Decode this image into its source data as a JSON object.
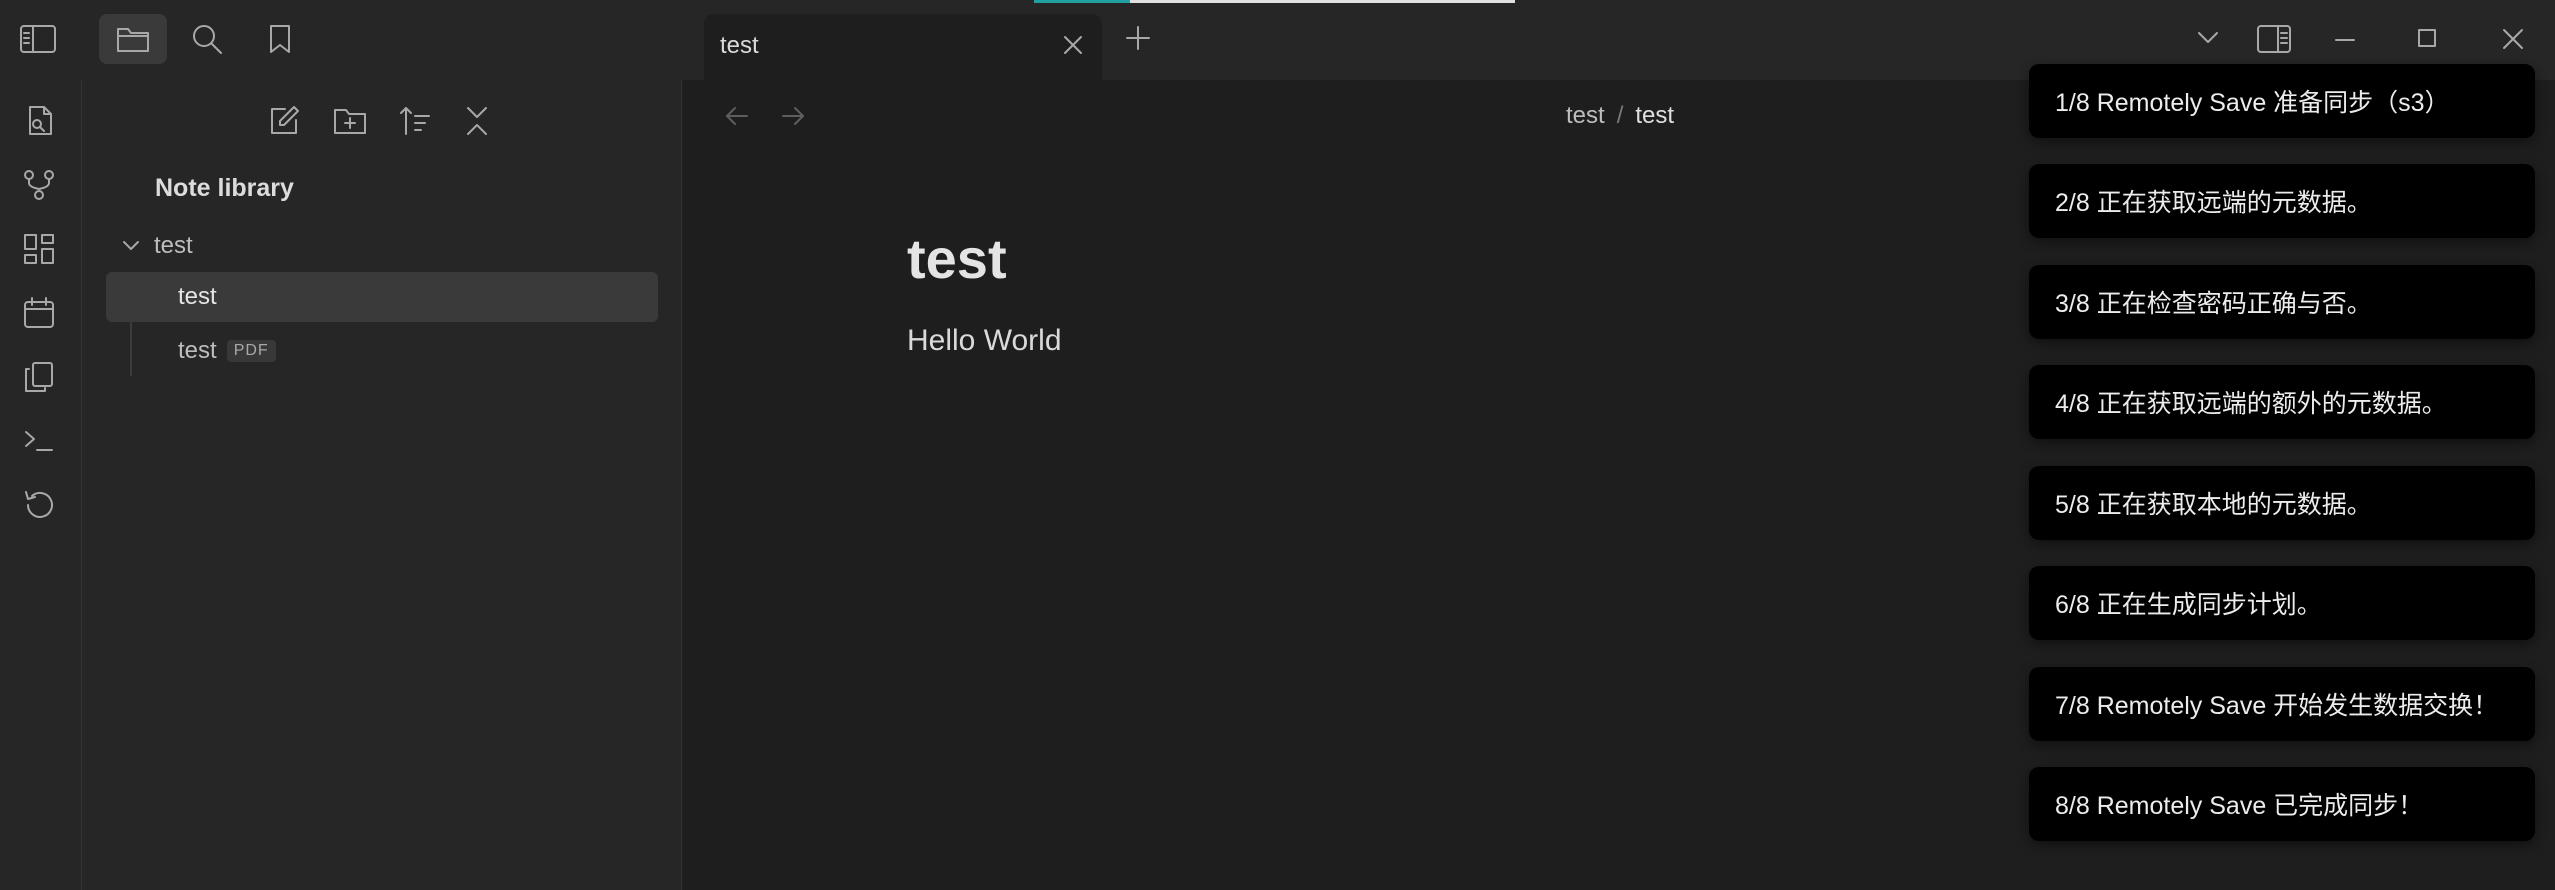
{
  "tab": {
    "title": "test"
  },
  "sidebar": {
    "library_title": "Note library",
    "folder": {
      "name": "test"
    },
    "files": [
      {
        "name": "test",
        "badge": ""
      },
      {
        "name": "test",
        "badge": "PDF"
      }
    ]
  },
  "main": {
    "breadcrumb": [
      "test",
      "test"
    ],
    "breadcrumb_separator": "/",
    "note_title": "test",
    "note_body": "Hello World"
  },
  "notices": [
    "1/8 Remotely Save 准备同步（s3）",
    "2/8 正在获取远端的元数据。",
    "3/8 正在检查密码正确与否。",
    "4/8 正在获取远端的额外的元数据。",
    "5/8 正在获取本地的元数据。",
    "6/8 正在生成同步计划。",
    "7/8 Remotely Save 开始发生数据交换！",
    "8/8 Remotely Save 已完成同步！"
  ],
  "colors": {
    "accent_progress": "#20a0a0",
    "notice_bg": "#000000",
    "background": "#1e1e1e",
    "panel": "#262626"
  },
  "icons": {
    "titlebar": [
      "sidebar-toggle-icon",
      "folder-icon",
      "search-icon",
      "bookmark-icon"
    ],
    "ribbon": [
      "file-search-icon",
      "graph-icon",
      "canvas-grid-icon",
      "calendar-icon",
      "copy-icon",
      "terminal-icon",
      "history-icon"
    ],
    "sidebar_tools": [
      "new-note-icon",
      "new-folder-icon",
      "sort-icon",
      "collapse-icon"
    ]
  }
}
